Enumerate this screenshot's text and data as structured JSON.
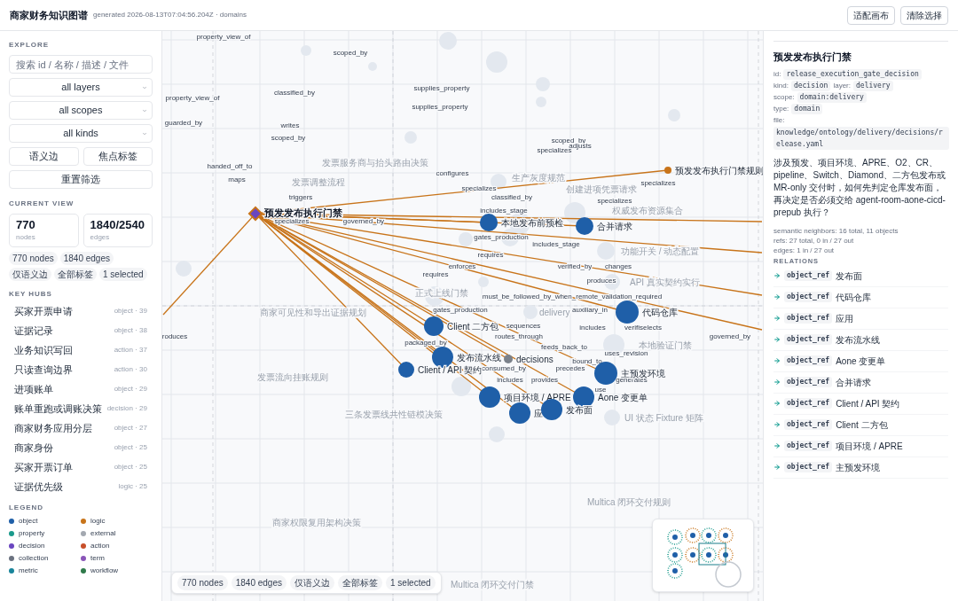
{
  "header": {
    "title": "商家财务知识图谱",
    "subtitle": "generated 2026-08-13T07:04:56.204Z · domains",
    "buttons": [
      "适配画布",
      "清除选择"
    ]
  },
  "sidebar": {
    "explore_heading": "EXPLORE",
    "search": {
      "placeholder": "搜索 id / 名称 / 描述 / 文件"
    },
    "selects": [
      "all layers",
      "all scopes",
      "all kinds"
    ],
    "toggles": [
      "语义边",
      "焦点标签"
    ],
    "reset": "重置筛选",
    "current_view_heading": "CURRENT VIEW",
    "stats": [
      {
        "value": "770",
        "label": "nodes"
      },
      {
        "value": "1840/2540",
        "label": "edges"
      }
    ],
    "chips": [
      "770 nodes",
      "1840 edges",
      "仅语义边",
      "全部标签",
      "1 selected"
    ],
    "hubs_heading": "KEY HUBS",
    "hubs": [
      {
        "name": "买家开票申请",
        "meta": "object · 39"
      },
      {
        "name": "证据记录",
        "meta": "object · 38"
      },
      {
        "name": "业务知识写回",
        "meta": "action · 37"
      },
      {
        "name": "只读查询边界",
        "meta": "action · 30"
      },
      {
        "name": "进项账单",
        "meta": "object · 29"
      },
      {
        "name": "账单重跑或调账决策",
        "meta": "decision · 29"
      },
      {
        "name": "商家财务应用分层",
        "meta": "object · 27"
      },
      {
        "name": "商家身份",
        "meta": "object · 25"
      },
      {
        "name": "买家开票订单",
        "meta": "object · 25"
      },
      {
        "name": "证据优先级",
        "meta": "logic · 25"
      }
    ],
    "legend_heading": "LEGEND",
    "legend": [
      {
        "label": "object",
        "color": "#1f5fa8"
      },
      {
        "label": "logic",
        "color": "#c8741a"
      },
      {
        "label": "property",
        "color": "#1a9a8c"
      },
      {
        "label": "external",
        "color": "#a3a8b0"
      },
      {
        "label": "decision",
        "color": "#6a46c0"
      },
      {
        "label": "action",
        "color": "#c8502a"
      },
      {
        "label": "collection",
        "color": "#6b7280"
      },
      {
        "label": "term",
        "color": "#8a55b8"
      },
      {
        "label": "metric",
        "color": "#18849a"
      },
      {
        "label": "workflow",
        "color": "#2f7a4a"
      }
    ]
  },
  "graph": {
    "selected_node": {
      "label": "预发发布执行门禁",
      "kind": "decision"
    },
    "nodes": [
      {
        "label": "预发发布执行门禁规则",
        "kind": "logic"
      },
      {
        "label": "本地发布前预检",
        "kind": "object"
      },
      {
        "label": "合并请求",
        "kind": "object"
      },
      {
        "label": "代码仓库",
        "kind": "object"
      },
      {
        "label": "Client 二方包",
        "kind": "object"
      },
      {
        "label": "发布流水线",
        "kind": "object"
      },
      {
        "label": "Client / API 契约",
        "kind": "object"
      },
      {
        "label": "decisions",
        "kind": "collection"
      },
      {
        "label": "主预发环境",
        "kind": "object"
      },
      {
        "label": "项目环境 / APRE",
        "kind": "object"
      },
      {
        "label": "Aone 变更单",
        "kind": "object"
      },
      {
        "label": "应",
        "kind": "object"
      },
      {
        "label": "发布面",
        "kind": "object"
      }
    ],
    "edge_labels": [
      "property_view_of",
      "scoped_by",
      "supplies_property",
      "classified_by",
      "property_view_of",
      "supplies_property",
      "guarded_by",
      "writes",
      "scoped_by",
      "scoped_by",
      "adjusts",
      "specializes",
      "handed_off_to",
      "configures",
      "maps",
      "specializes",
      "specializes",
      "triggers",
      "classified_by",
      "specializes",
      "includes_stage",
      "specializes",
      "governed_by",
      "gates_production",
      "includes_stage",
      "requires",
      "enforces",
      "verified_by",
      "changes",
      "requires",
      "produces",
      "must_be_followed_by_when_remote_validation_required",
      "gates_production",
      "auxiliary_in",
      "sequences",
      "includes",
      "verifiselects",
      "roduces",
      "routes_through",
      "governed_by",
      "packaged_by",
      "feeds_back_to",
      "uses_revision",
      "bound_to",
      "consumed_by",
      "precedes",
      "includes",
      "provides",
      "generates",
      "use"
    ],
    "faded_labels": [
      "发票服务商与抬头路由决策",
      "发票调整流程",
      "生产灰度规范",
      "创建进项凭票请求",
      "权威发布资源集合",
      "功能开关 / 动态配置",
      "API 真实契约实行",
      "正式上线门禁",
      "delivery",
      "本地验证门禁",
      "三条发票线共性链模决策",
      "UI 状态 Fixture 矩阵",
      "商家可见性和导出证据规划",
      "发票流向挂账规则",
      "商家权限复用架构决策",
      "Multica 闭环交付规则",
      "Multica 闭环交付门禁"
    ],
    "chips": [
      "770 nodes",
      "1840 edges",
      "仅语义边",
      "全部标签",
      "1 selected"
    ]
  },
  "details": {
    "title": "预发发布执行门禁",
    "fields": [
      [
        {
          "label": "id:",
          "code": "release_execution_gate_decision"
        }
      ],
      [
        {
          "label": "kind:",
          "code": "decision"
        },
        {
          "label": "layer:",
          "code": "delivery"
        }
      ],
      [
        {
          "label": "scope:",
          "code": "domain:delivery"
        }
      ],
      [
        {
          "label": "type:",
          "code": "domain"
        }
      ]
    ],
    "file": {
      "label": "file:",
      "code": "knowledge/ontology/delivery/decisions/release.yaml"
    },
    "description": "涉及预发、项目环境、APRE、O2、CR、pipeline、Switch、Diamond、二方包发布或 MR-only 交付时，如何先判定仓库发布面，再决定是否必须交给 agent-room-aone-cicd-prepub 执行？",
    "stats": [
      "semantic neighbors: 16 total, 11 objects",
      "refs: 27 total, 0 in / 27 out",
      "edges: 1 in / 27 out"
    ],
    "relations_heading": "RELATIONS",
    "relations": [
      {
        "kind": "object_ref",
        "target": "发布面"
      },
      {
        "kind": "object_ref",
        "target": "代码仓库"
      },
      {
        "kind": "object_ref",
        "target": "应用"
      },
      {
        "kind": "object_ref",
        "target": "发布流水线"
      },
      {
        "kind": "object_ref",
        "target": "Aone 变更单"
      },
      {
        "kind": "object_ref",
        "target": "合并请求"
      },
      {
        "kind": "object_ref",
        "target": "Client / API 契约"
      },
      {
        "kind": "object_ref",
        "target": "Client 二方包"
      },
      {
        "kind": "object_ref",
        "target": "项目环境 / APRE"
      },
      {
        "kind": "object_ref",
        "target": "主预发环境"
      }
    ]
  }
}
